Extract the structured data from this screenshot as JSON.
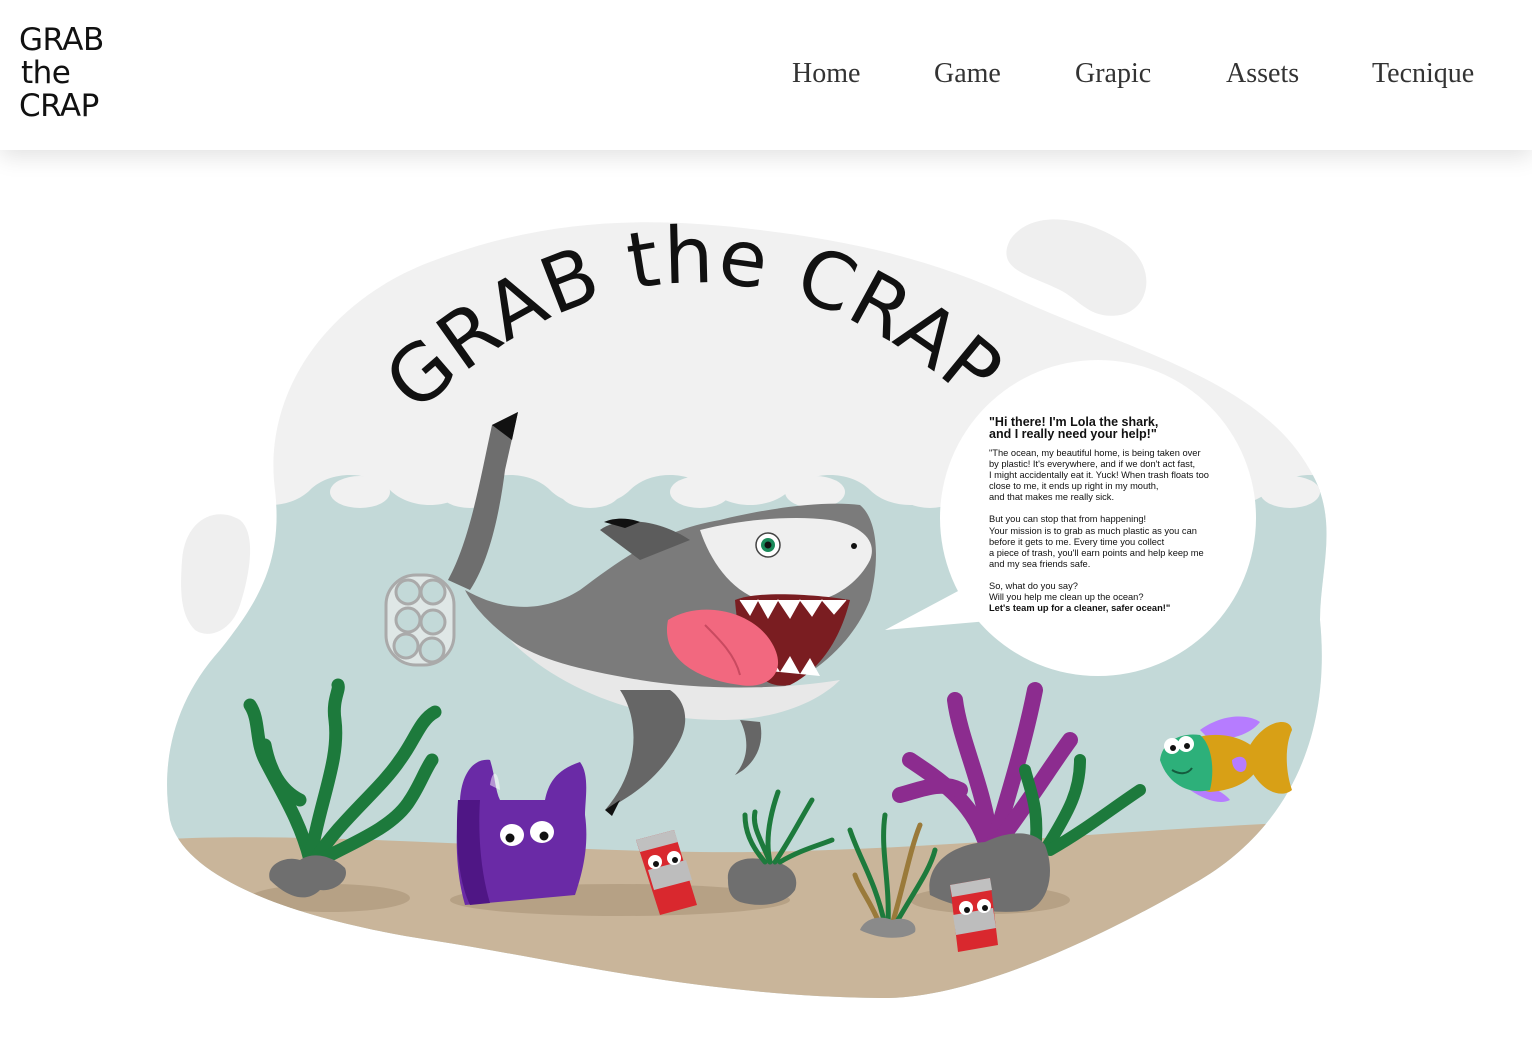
{
  "logo": {
    "lines": [
      "GRAB",
      "the",
      "CRAP"
    ]
  },
  "nav": {
    "items": [
      {
        "label": "Home"
      },
      {
        "label": "Game"
      },
      {
        "label": "Grapic"
      },
      {
        "label": "Assets"
      },
      {
        "label": "Tecnique"
      }
    ]
  },
  "hero": {
    "title": "GRAB the CRAP",
    "speech": {
      "intro": [
        "\"Hi there! I'm Lola the shark,",
        "and I really need your help!\""
      ],
      "paragraph1": [
        "\"The ocean, my beautiful home, is being taken over",
        "by plastic! It's everywhere, and if we don't act fast,",
        "I might accidentally eat it. Yuck! When trash floats too",
        "close to me, it ends up right in my mouth,",
        "and that makes me really sick."
      ],
      "paragraph2": [
        "But you can stop that from happening!",
        "Your mission is to grab as much plastic as you can",
        "before it gets to me. Every time you collect",
        "a piece of trash, you'll earn points and help keep me",
        "and my sea friends safe."
      ],
      "paragraph3": [
        "So, what do you say?",
        "Will you help me clean up the ocean?"
      ],
      "closing": "Let's team up for a cleaner, safer ocean!\""
    }
  },
  "colors": {
    "blob": "#f1f1f1",
    "water": "#c3d9d8",
    "sand": "#c9b59a",
    "shark": "#7b7b7b",
    "seaweed_green": "#1d7a3c",
    "coral_purple": "#8c2c8f",
    "bag_purple": "#6a2aa6",
    "can_red": "#d9282e"
  }
}
